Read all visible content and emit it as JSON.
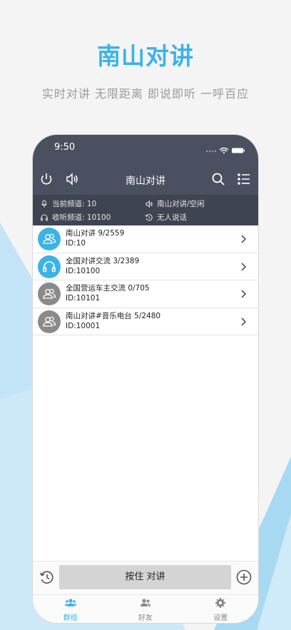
{
  "promo": {
    "title": "南山对讲",
    "tagline": "实时对讲 无限距离 即说即听 一呼百应"
  },
  "status_bar": {
    "time": "9:50"
  },
  "nav": {
    "title": "南山对讲"
  },
  "info": {
    "current_channel": "当前频道: 10",
    "listen_channel": "收听频道: 10100",
    "channel_state": "南山对讲/空闲",
    "speaker_state": "无人说话"
  },
  "channels": [
    {
      "name": "南山对讲 9/2559",
      "id": "ID:10",
      "color": "#3bb3e6",
      "icon": "group-icon"
    },
    {
      "name": "全国对讲交流 3/2389",
      "id": "ID:10100",
      "color": "#3bb3e6",
      "icon": "headphones-icon"
    },
    {
      "name": "全国营运车主交流 0/705",
      "id": "ID:10101",
      "color": "#8a8a8a",
      "icon": "group-icon"
    },
    {
      "name": "南山对讲#音乐电台 5/2480",
      "id": "ID:10001",
      "color": "#8a8a8a",
      "icon": "group-icon"
    }
  ],
  "bottom": {
    "ptt_label": "按住 对讲",
    "tabs": [
      {
        "label": "群组",
        "icon": "groups-icon",
        "active": true
      },
      {
        "label": "好友",
        "icon": "friends-icon",
        "active": false
      },
      {
        "label": "设置",
        "icon": "settings-icon",
        "active": false
      }
    ]
  },
  "colors": {
    "accent": "#3bb3e6",
    "topbar": "#4a5060",
    "infobar": "#3e4452"
  }
}
